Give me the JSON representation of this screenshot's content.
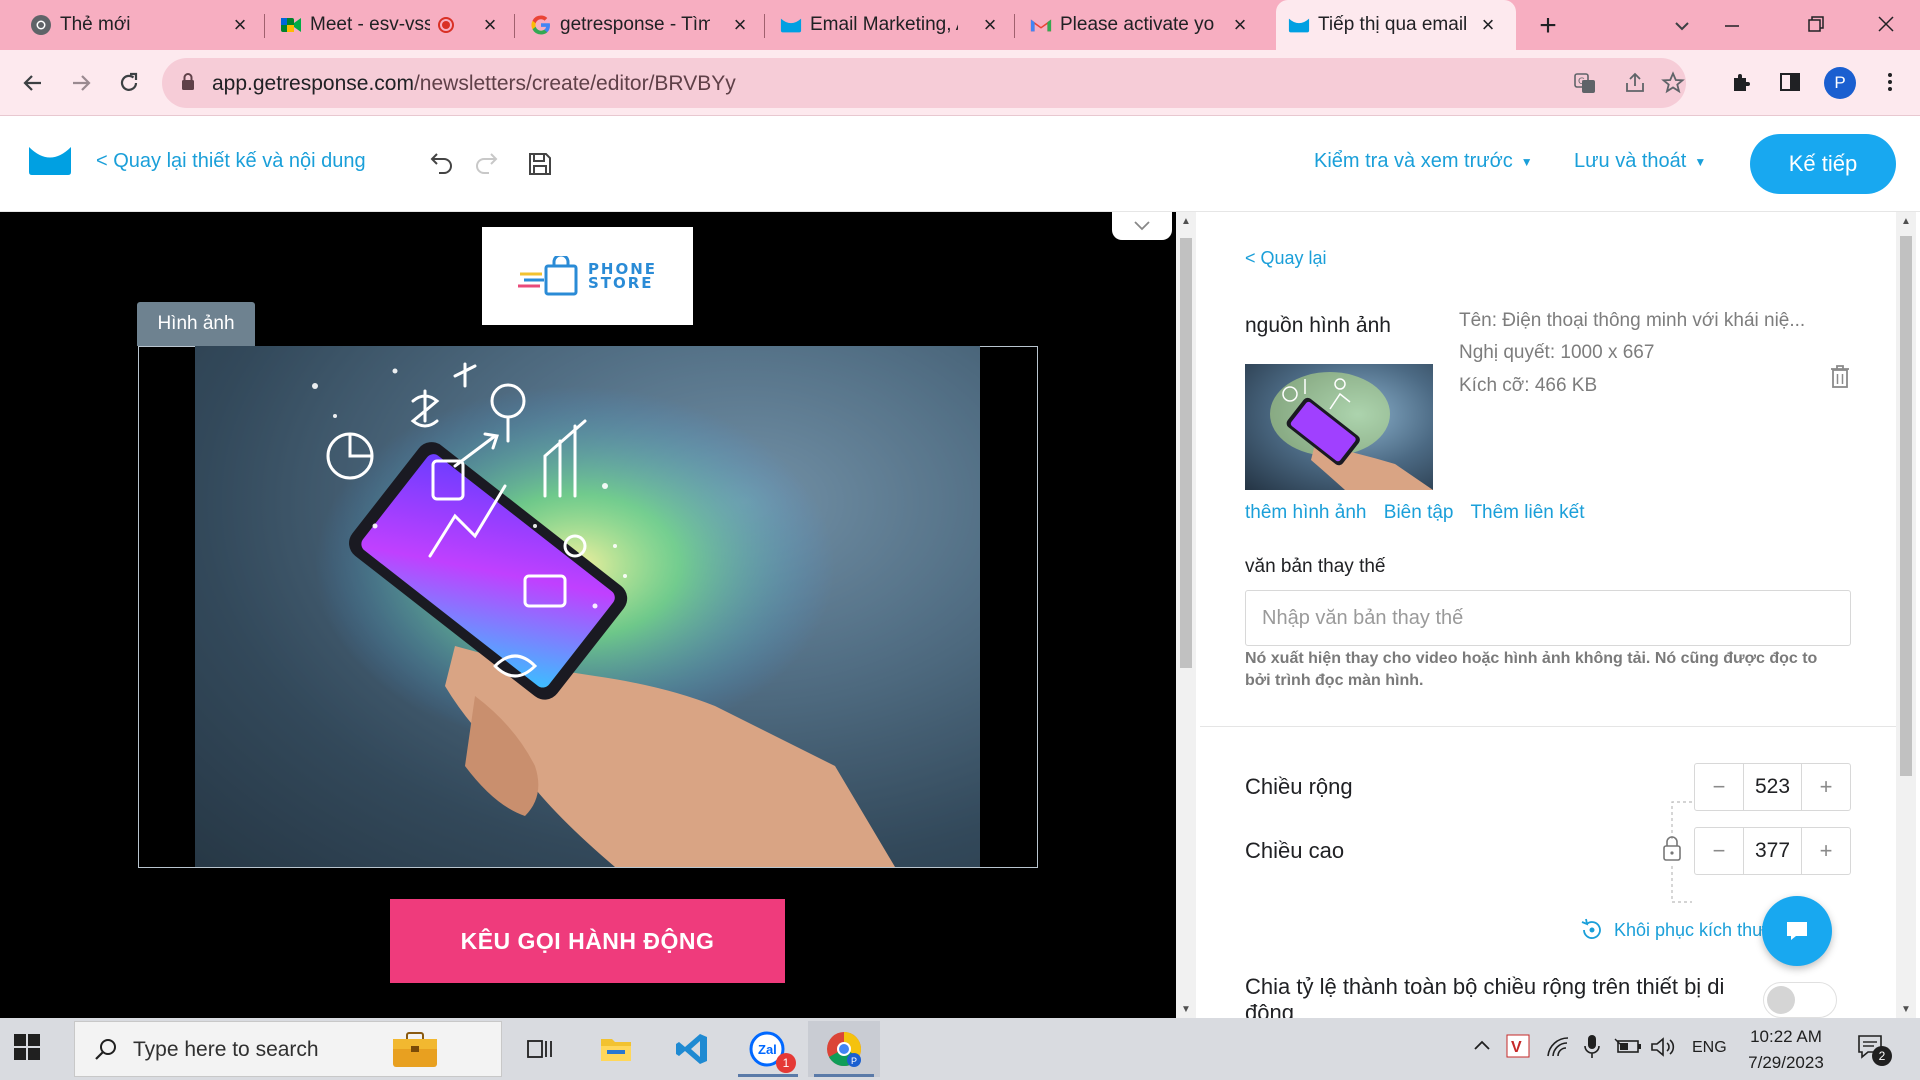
{
  "browser": {
    "tabs": [
      {
        "label": "Thẻ mới",
        "icon": "chrome-icon"
      },
      {
        "label": "Meet - esv-vssh",
        "icon": "meet-icon",
        "recording": true
      },
      {
        "label": "getresponse - Tìm trên Google",
        "icon": "google-icon"
      },
      {
        "label": "Email Marketing, Automation",
        "icon": "getresponse-icon"
      },
      {
        "label": "Please activate your",
        "icon": "gmail-icon"
      },
      {
        "label": "Tiếp thị qua email, ",
        "icon": "getresponse-icon",
        "active": true
      }
    ],
    "url_host": "app.getresponse.com",
    "url_path": "/newsletters/create/editor/BRVBYy",
    "profile_initial": "P"
  },
  "header": {
    "back_label": "< Quay lại thiết kế và nội dung",
    "preview_menu": "Kiểm tra và xem trước",
    "save_menu": "Lưu và thoát",
    "next_label": "Kế tiếp"
  },
  "canvas": {
    "logo_line1": "PHONE",
    "logo_line2": "STORE",
    "block_label": "Hình ảnh",
    "cta_label": "KÊU GỌI HÀNH ĐỘNG"
  },
  "panel": {
    "back_label": "< Quay lại",
    "source_title": "nguồn hình ảnh",
    "name_line": "Tên:  Điện thoại thông minh với khái niệ...",
    "resolution_line": "Nghị quyết: 1000 x 667",
    "size_line": "Kích cỡ: 466 KB",
    "link_add": "thêm hình ảnh",
    "link_edit": "Biên tập",
    "link_link": "Thêm liên kết",
    "alt_label": "văn bản thay thế",
    "alt_placeholder": "Nhập văn bản thay thế",
    "alt_value": "",
    "alt_help": "Nó xuất hiện thay cho video hoặc hình ảnh không tải. Nó cũng được đọc to bởi trình đọc màn hình.",
    "width_label": "Chiều rộng",
    "width_value": "523",
    "height_label": "Chiều cao",
    "height_value": "377",
    "reset_label": "Khôi phục kích thước b",
    "scale_label": "Chia tỷ lệ thành toàn bộ chiều rộng trên thiết bị di động",
    "scale_toggle_on": false
  },
  "taskbar": {
    "search_placeholder": "Type here to search",
    "zalo_badge": "1",
    "lang": "ENG",
    "time": "10:22 AM",
    "date": "7/29/2023",
    "notif_count": "2"
  },
  "colors": {
    "tab_strip": "#f7aec1",
    "accent_blue": "#1a9fd9",
    "next_button": "#18a8f0",
    "cta_pink": "#ef3b7c"
  }
}
